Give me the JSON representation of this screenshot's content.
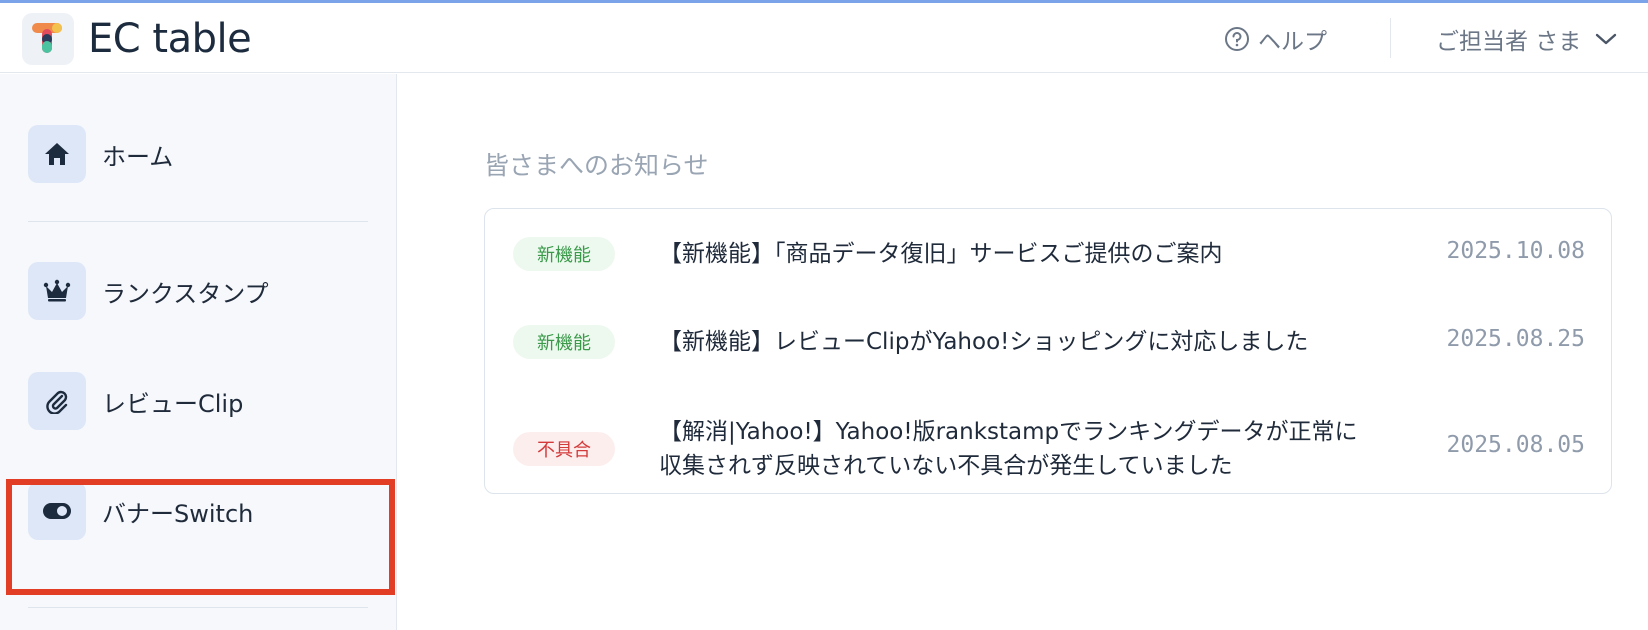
{
  "header": {
    "brand": "EC table",
    "help_label": "ヘルプ",
    "account_label": "ご担当者 さま"
  },
  "sidebar": {
    "items": [
      {
        "label": "ホーム",
        "icon": "home-icon"
      },
      {
        "label": "ランクスタンプ",
        "icon": "crown-icon"
      },
      {
        "label": "レビューClip",
        "icon": "paperclip-icon"
      },
      {
        "label": "バナーSwitch",
        "icon": "toggle-icon"
      }
    ],
    "highlighted_item": "バナーSwitch"
  },
  "main": {
    "section_title": "皆さまへのお知らせ",
    "news": [
      {
        "badge": "新機能",
        "badge_type": "green",
        "title": "【新機能】「商品データ復旧」サービスご提供のご案内",
        "date": "2025.10.08"
      },
      {
        "badge": "新機能",
        "badge_type": "green",
        "title": "【新機能】レビューClipがYahoo!ショッピングに対応しました",
        "date": "2025.08.25"
      },
      {
        "badge": "不具合",
        "badge_type": "red",
        "title": "【解消|Yahoo!】Yahoo!版rankstampでランキングデータが正常に収集されず反映されていない不具合が発生していました",
        "date": "2025.08.05"
      }
    ]
  },
  "colors": {
    "accent_line": "#7ba3ea",
    "highlight_border": "#e23d25",
    "badge_new_text": "#3a9a4a",
    "badge_bug_text": "#d33b3b"
  }
}
